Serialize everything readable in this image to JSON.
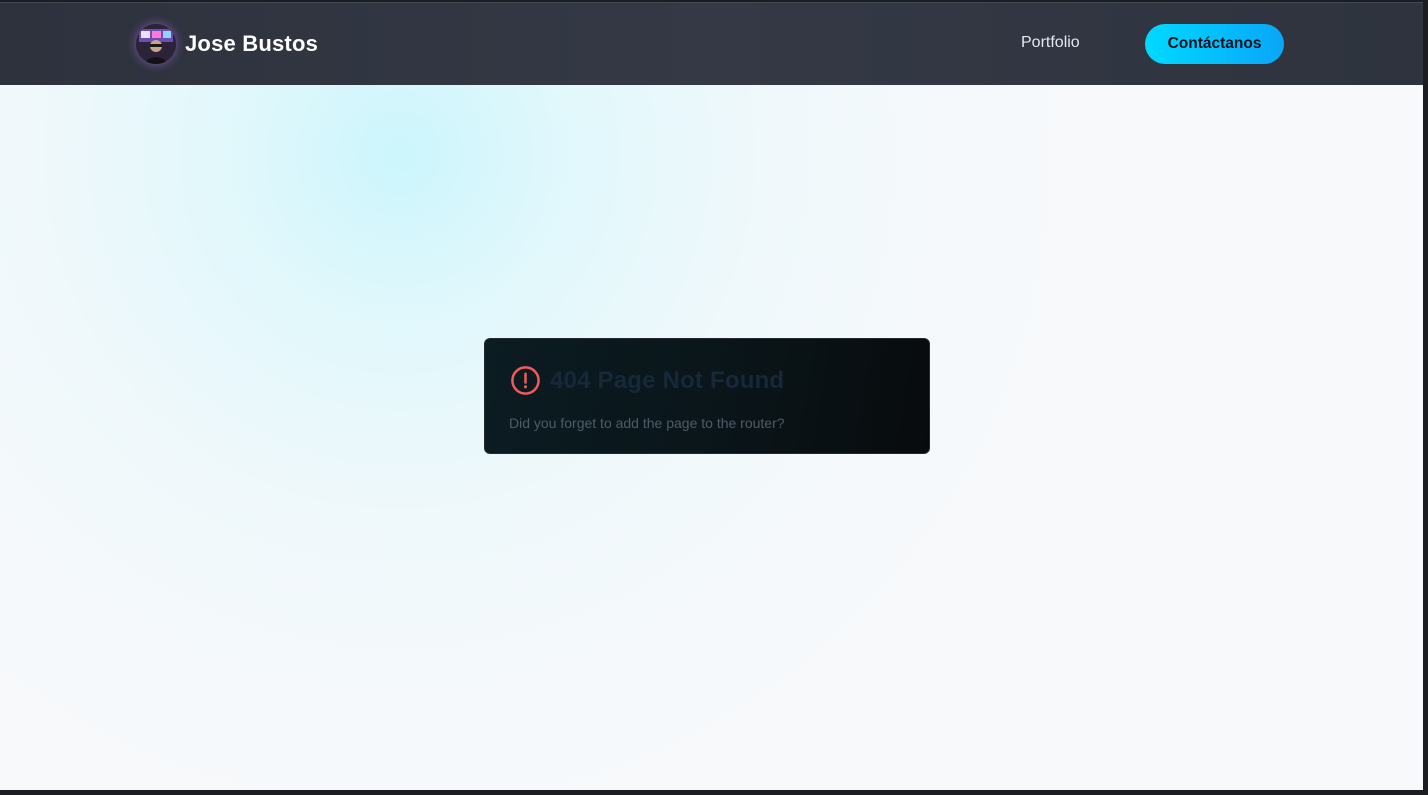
{
  "header": {
    "brand_name": "Jose Bustos",
    "nav": [
      {
        "label": "Portfolio"
      }
    ],
    "cta_label": "Contáctanos"
  },
  "error": {
    "title": "404 Page Not Found",
    "message": "Did you forget to add the page to the router?",
    "icon": "alert-circle-icon"
  },
  "colors": {
    "navbar_bg": "#343945",
    "cta_gradient_start": "#00d9ff",
    "cta_gradient_end": "#0aa6f7",
    "page_bg": "#f7f9fb",
    "glow": "#a7f3fc",
    "card_bg": "#0a1519",
    "error_icon": "#ef5b5b"
  }
}
